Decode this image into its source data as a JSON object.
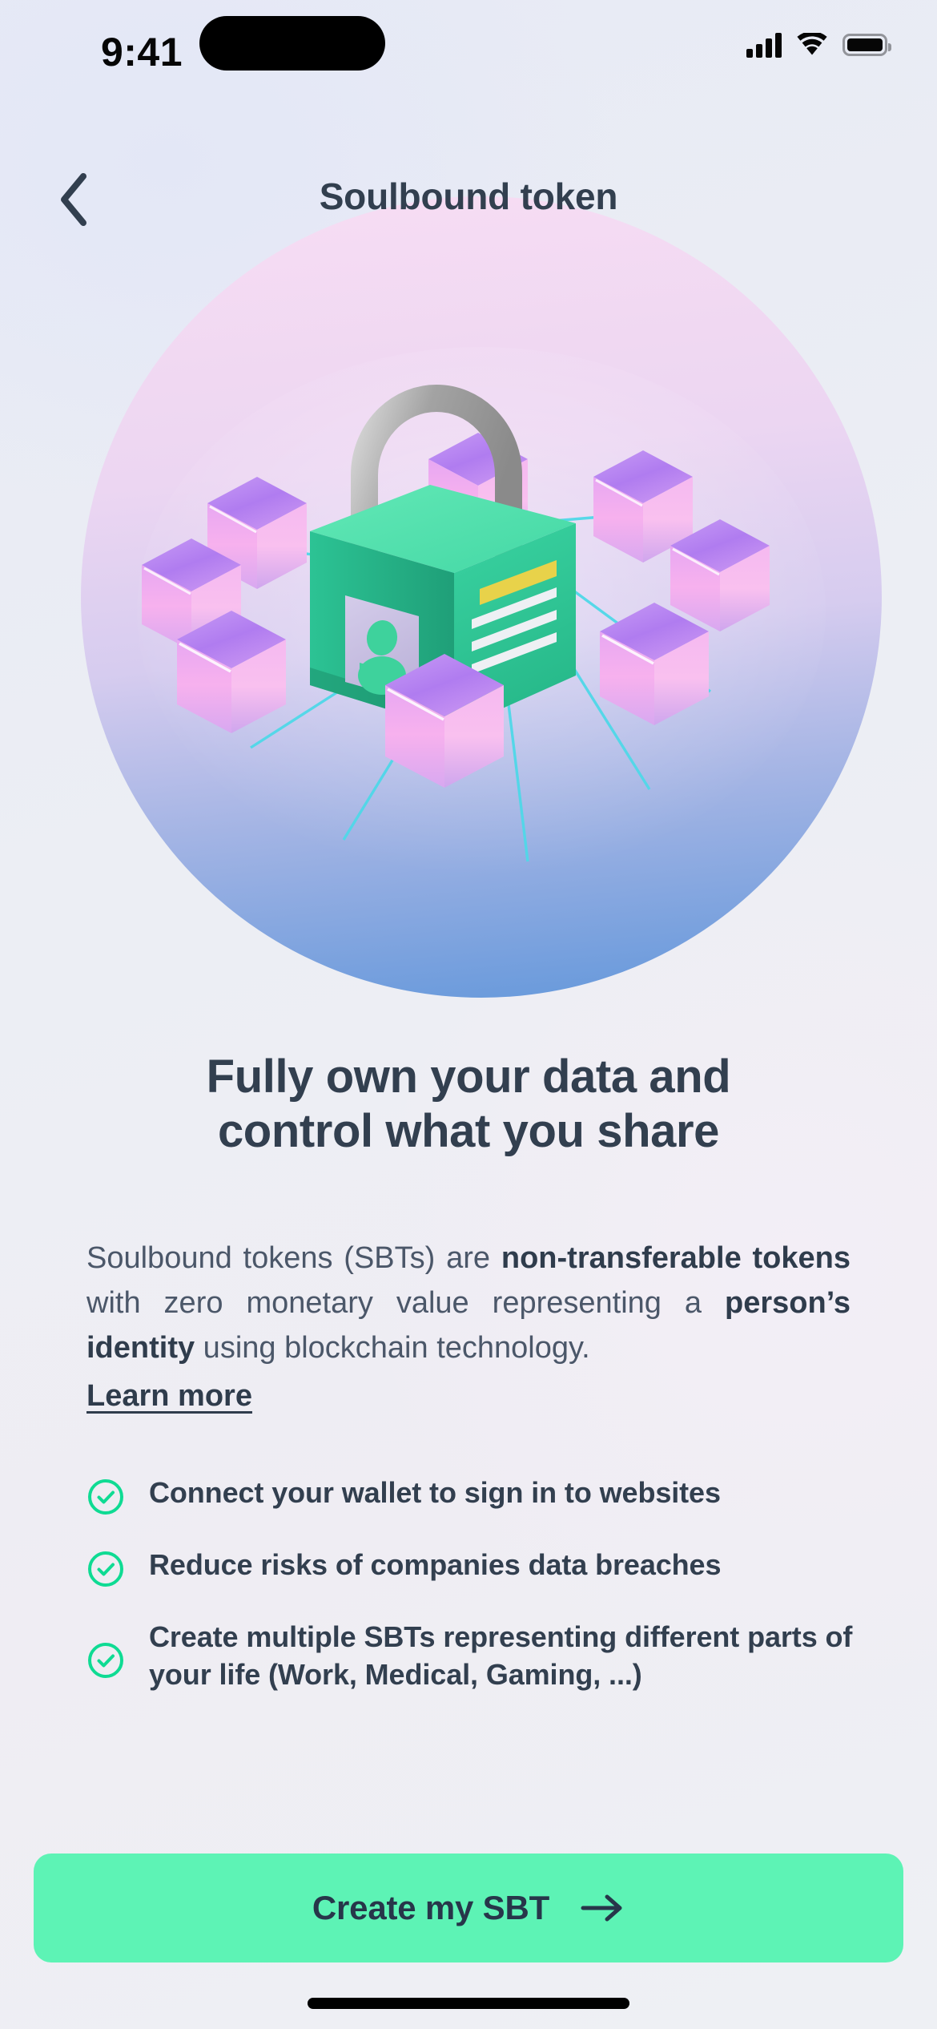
{
  "status_bar": {
    "time": "9:41",
    "cellular_icon": "cellular-signal-icon",
    "wifi_icon": "wifi-icon",
    "battery_icon": "battery-full-icon"
  },
  "nav": {
    "back_icon": "chevron-left-icon",
    "title": "Soulbound token"
  },
  "illustration": {
    "name": "soulbound-token-3d-illustration",
    "description": "3D green padlock with identity card surrounded by connected purple blockchain cubes",
    "colors": {
      "circle_top": "#f4d9f1",
      "circle_mid": "#d9cdf0",
      "circle_bottom": "#6f9ede",
      "lock_body": "#33c898",
      "lock_body_light": "#5fe0b0",
      "shackle": "#9a9a9a",
      "card": "#c9c2e0",
      "avatar": "#3ed29c",
      "accent_line": "#e8d24a",
      "link_line": "#4fd8e8",
      "cube_top": "#b47bf0",
      "cube_face": "#f5a8e8"
    }
  },
  "headline": {
    "line1": "Fully own your data and",
    "line2": "control what you share"
  },
  "body": {
    "part1": "Soulbound tokens (SBTs) are ",
    "bold1": "non-transferable tokens",
    "part2": " with zero monetary value representing a ",
    "bold2": "person’s identity",
    "part3": " using blockchain technology.",
    "learn_more": "Learn more"
  },
  "features": {
    "check_icon": "circle-check-icon",
    "items": [
      {
        "text": "Connect your wallet to sign in to websites"
      },
      {
        "text": "Reduce risks of companies data breaches"
      },
      {
        "text": "Create multiple SBTs representing different parts of your life (Work, Medical, Gaming, ...)"
      }
    ]
  },
  "cta": {
    "label": "Create my SBT",
    "arrow_icon": "arrow-right-icon",
    "background": "#5df3b5",
    "text_color": "#27364a"
  },
  "home_indicator": {
    "name": "home-indicator"
  }
}
